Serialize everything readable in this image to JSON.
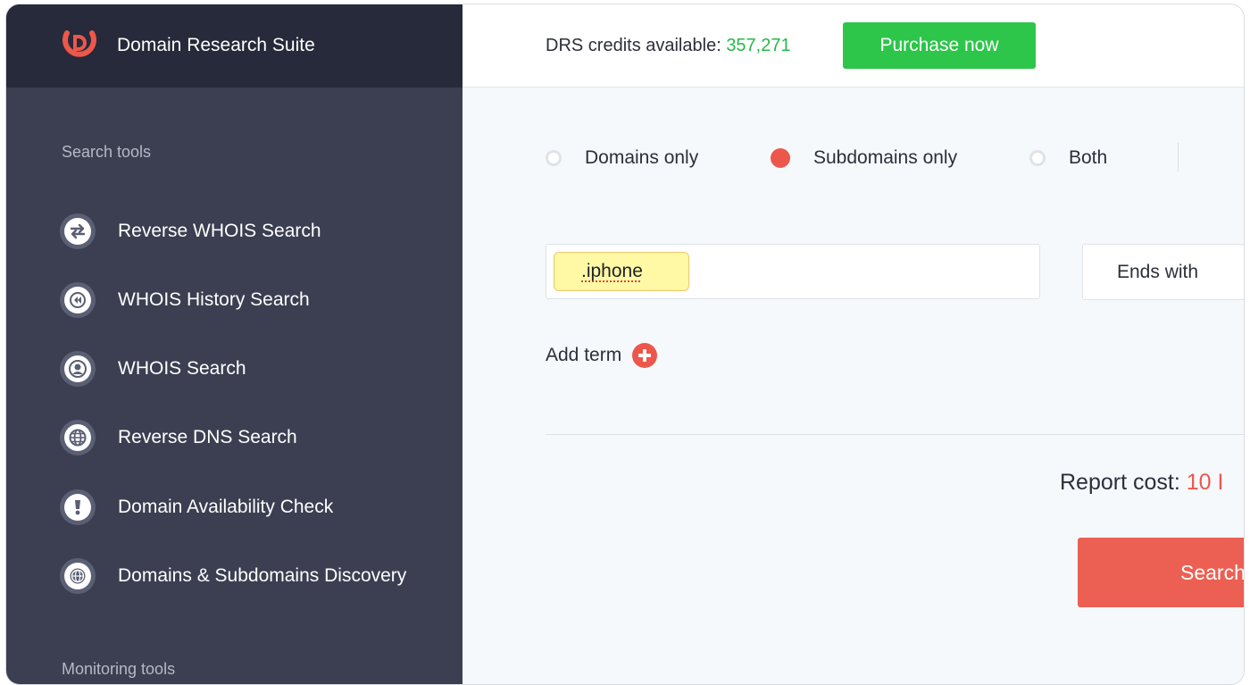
{
  "brand": {
    "name": "Domain Research Suite"
  },
  "sidebar": {
    "search_tools_label": "Search tools",
    "monitoring_tools_label": "Monitoring tools",
    "items": [
      {
        "label": "Reverse WHOIS Search",
        "icon": "reverse-arrows-icon"
      },
      {
        "label": "WHOIS History Search",
        "icon": "rewind-icon"
      },
      {
        "label": "WHOIS Search",
        "icon": "user-icon"
      },
      {
        "label": "Reverse DNS Search",
        "icon": "globe-icon"
      },
      {
        "label": "Domain Availability Check",
        "icon": "exclamation-icon"
      },
      {
        "label": "Domains & Subdomains Discovery",
        "icon": "globe-outline-icon"
      }
    ]
  },
  "topbar": {
    "credits_label": "DRS credits available: ",
    "credits_value": "357,271",
    "purchase_label": "Purchase now"
  },
  "filters": {
    "options": [
      {
        "label": "Domains only",
        "selected": false
      },
      {
        "label": "Subdomains only",
        "selected": true
      },
      {
        "label": "Both",
        "selected": false
      }
    ]
  },
  "search": {
    "term": ".iphone",
    "match_mode": "Ends with",
    "add_term_label": "Add term"
  },
  "report": {
    "cost_label": "Report cost: ",
    "cost_value": "10 I",
    "search_label": "Search"
  },
  "colors": {
    "accent": "#ec574c",
    "success": "#2dc54a",
    "sidebar": "#3b3f51",
    "sidebar_header": "#262a3a"
  }
}
